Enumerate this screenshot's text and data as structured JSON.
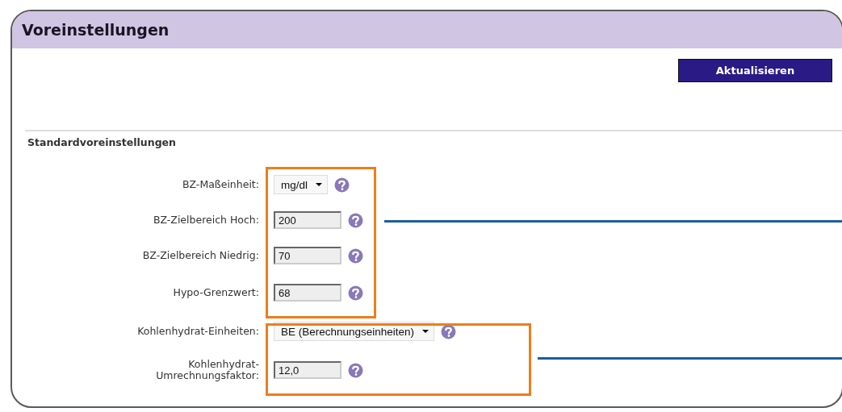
{
  "window": {
    "title": "Voreinstellungen"
  },
  "update_button": {
    "label": "Aktualisieren"
  },
  "section": {
    "title": "Standardvoreinstellungen"
  },
  "fields": [
    {
      "kind": "select",
      "label": "BZ-Maßeinheit:",
      "value": "mg/dl"
    },
    {
      "kind": "input",
      "label": "BZ-Zielbereich Hoch:",
      "value": "200"
    },
    {
      "kind": "input",
      "label": "BZ-Zielbereich Niedrig:",
      "value": "70"
    },
    {
      "kind": "input",
      "label": "Hypo-Grenzwert:",
      "value": "68"
    },
    {
      "kind": "select",
      "label": "Kohlenhydrat-Einheiten:",
      "value": "BE (Berechnungseinheiten)"
    },
    {
      "kind": "input",
      "label": "Kohlenhydrat-Umrechnungsfaktor:",
      "value": "12,0"
    }
  ]
}
